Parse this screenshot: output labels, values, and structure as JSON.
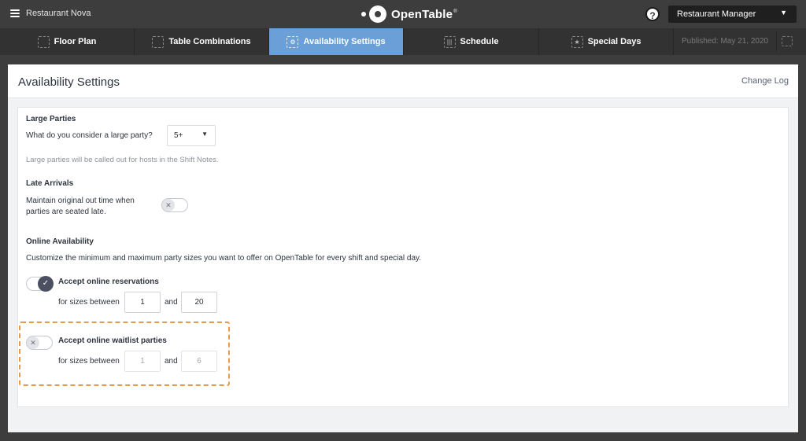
{
  "app": {
    "restaurant_name": "Restaurant Nova",
    "logo_text": "OpenTable",
    "logo_tm": "®",
    "help_glyph": "?",
    "role_select": "Restaurant Manager"
  },
  "tabs": [
    {
      "label": "Floor Plan",
      "icon": "floor-plan-icon",
      "active": false
    },
    {
      "label": "Table Combinations",
      "icon": "table-combinations-icon",
      "active": false
    },
    {
      "label": "Availability Settings",
      "icon": "availability-settings-icon",
      "active": true
    },
    {
      "label": "Schedule",
      "icon": "schedule-icon",
      "active": false
    },
    {
      "label": "Special Days",
      "icon": "special-days-icon",
      "active": false
    }
  ],
  "published": "Published: May 21, 2020",
  "page": {
    "title": "Availability Settings",
    "change_log": "Change Log"
  },
  "large_parties": {
    "title": "Large Parties",
    "question": "What do you consider a large party?",
    "value": "5+",
    "hint": "Large parties will be called out for hosts in the Shift Notes."
  },
  "late_arrivals": {
    "title": "Late Arrivals",
    "line1": "Maintain original out time when",
    "line2": "parties are seated late.",
    "enabled": false
  },
  "online": {
    "title": "Online Availability",
    "description": "Customize the minimum and maximum party sizes you want to offer on OpenTable for every shift and special day.",
    "reservations": {
      "label": "Accept online reservations",
      "enabled": true,
      "sizes_label": "for sizes between",
      "and_label": "and",
      "min": "1",
      "max": "20"
    },
    "waitlist": {
      "label": "Accept online waitlist parties",
      "enabled": false,
      "sizes_label": "for sizes between",
      "and_label": "and",
      "min": "1",
      "max": "6"
    }
  },
  "colors": {
    "active_tab": "#6b9fd8",
    "highlight": "#e69a4c"
  }
}
